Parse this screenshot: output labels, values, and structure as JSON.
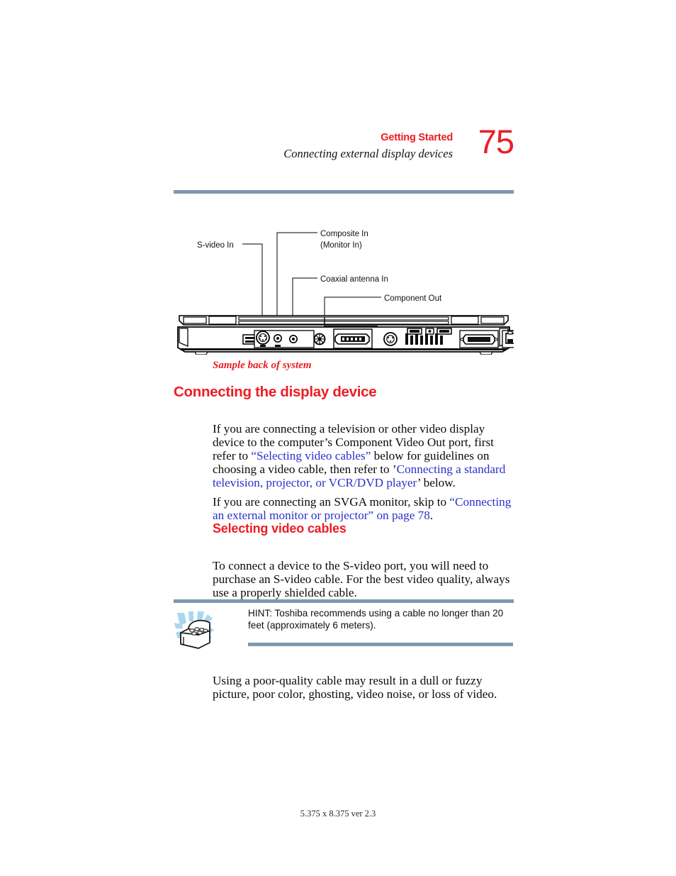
{
  "header": {
    "chapter": "Getting Started",
    "section": "Connecting external display devices",
    "page_number": "75",
    "rule_color": "#8097b1",
    "accent_color": "#ec1c24"
  },
  "figure": {
    "labels": {
      "s_video_in": "S-video In",
      "composite_in_line1": "Composite In",
      "composite_in_line2": "(Monitor In)",
      "coaxial_antenna_in": "Coaxial antenna In",
      "component_out": "Component Out"
    },
    "caption": "Sample back of system",
    "caption_color": "#ec1c24",
    "alt": "Illustration of the back panel of a notebook computer showing connector ports"
  },
  "headings": {
    "connecting_display_device": "Connecting the display device",
    "selecting_video_cables": "Selecting video cables",
    "heading_color": "#ee1c25"
  },
  "body": {
    "link_color": "#2b32c8",
    "paragraph_1": {
      "seg_1": "If you are connecting a television or other video display device to the computer’s Component Video Out port, first refer to ",
      "link_1": "“Selecting video cables”",
      "seg_2": " below for guidelines on choosing a video cable, then refer to ’",
      "link_2": "Connecting a standard television, projector, or VCR/DVD player",
      "seg_3": "’ below."
    },
    "paragraph_2": {
      "seg_1": "If you are connecting an SVGA monitor, skip to ",
      "link_1": "“Connecting an external monitor or projector” on page 78",
      "seg_2": "."
    },
    "paragraph_3": "To connect a device to the S-video port, you will need to purchase an S-video cable. For the best video quality, always use a properly shielded cable.",
    "paragraph_4": "Using a poor-quality cable may result in a dull or fuzzy picture, poor color, ghosting, video noise, or loss of video."
  },
  "hint": {
    "text": "HINT: Toshiba recommends using a cable no longer than 20 feet (approximately 6 meters).",
    "icon": "treasure-chest-icon",
    "icon_accent_color": "#a9d7f0"
  },
  "footer": {
    "text": "5.375 x 8.375 ver 2.3"
  }
}
